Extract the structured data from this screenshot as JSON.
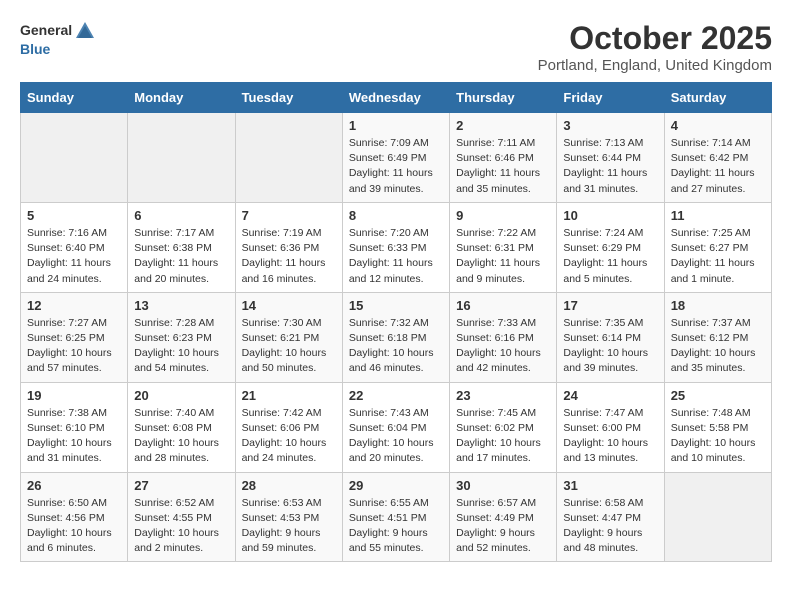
{
  "logo": {
    "general": "General",
    "blue": "Blue"
  },
  "title": "October 2025",
  "location": "Portland, England, United Kingdom",
  "days_of_week": [
    "Sunday",
    "Monday",
    "Tuesday",
    "Wednesday",
    "Thursday",
    "Friday",
    "Saturday"
  ],
  "weeks": [
    [
      {
        "day": "",
        "sunrise": "",
        "sunset": "",
        "daylight": ""
      },
      {
        "day": "",
        "sunrise": "",
        "sunset": "",
        "daylight": ""
      },
      {
        "day": "",
        "sunrise": "",
        "sunset": "",
        "daylight": ""
      },
      {
        "day": "1",
        "sunrise": "Sunrise: 7:09 AM",
        "sunset": "Sunset: 6:49 PM",
        "daylight": "Daylight: 11 hours and 39 minutes."
      },
      {
        "day": "2",
        "sunrise": "Sunrise: 7:11 AM",
        "sunset": "Sunset: 6:46 PM",
        "daylight": "Daylight: 11 hours and 35 minutes."
      },
      {
        "day": "3",
        "sunrise": "Sunrise: 7:13 AM",
        "sunset": "Sunset: 6:44 PM",
        "daylight": "Daylight: 11 hours and 31 minutes."
      },
      {
        "day": "4",
        "sunrise": "Sunrise: 7:14 AM",
        "sunset": "Sunset: 6:42 PM",
        "daylight": "Daylight: 11 hours and 27 minutes."
      }
    ],
    [
      {
        "day": "5",
        "sunrise": "Sunrise: 7:16 AM",
        "sunset": "Sunset: 6:40 PM",
        "daylight": "Daylight: 11 hours and 24 minutes."
      },
      {
        "day": "6",
        "sunrise": "Sunrise: 7:17 AM",
        "sunset": "Sunset: 6:38 PM",
        "daylight": "Daylight: 11 hours and 20 minutes."
      },
      {
        "day": "7",
        "sunrise": "Sunrise: 7:19 AM",
        "sunset": "Sunset: 6:36 PM",
        "daylight": "Daylight: 11 hours and 16 minutes."
      },
      {
        "day": "8",
        "sunrise": "Sunrise: 7:20 AM",
        "sunset": "Sunset: 6:33 PM",
        "daylight": "Daylight: 11 hours and 12 minutes."
      },
      {
        "day": "9",
        "sunrise": "Sunrise: 7:22 AM",
        "sunset": "Sunset: 6:31 PM",
        "daylight": "Daylight: 11 hours and 9 minutes."
      },
      {
        "day": "10",
        "sunrise": "Sunrise: 7:24 AM",
        "sunset": "Sunset: 6:29 PM",
        "daylight": "Daylight: 11 hours and 5 minutes."
      },
      {
        "day": "11",
        "sunrise": "Sunrise: 7:25 AM",
        "sunset": "Sunset: 6:27 PM",
        "daylight": "Daylight: 11 hours and 1 minute."
      }
    ],
    [
      {
        "day": "12",
        "sunrise": "Sunrise: 7:27 AM",
        "sunset": "Sunset: 6:25 PM",
        "daylight": "Daylight: 10 hours and 57 minutes."
      },
      {
        "day": "13",
        "sunrise": "Sunrise: 7:28 AM",
        "sunset": "Sunset: 6:23 PM",
        "daylight": "Daylight: 10 hours and 54 minutes."
      },
      {
        "day": "14",
        "sunrise": "Sunrise: 7:30 AM",
        "sunset": "Sunset: 6:21 PM",
        "daylight": "Daylight: 10 hours and 50 minutes."
      },
      {
        "day": "15",
        "sunrise": "Sunrise: 7:32 AM",
        "sunset": "Sunset: 6:18 PM",
        "daylight": "Daylight: 10 hours and 46 minutes."
      },
      {
        "day": "16",
        "sunrise": "Sunrise: 7:33 AM",
        "sunset": "Sunset: 6:16 PM",
        "daylight": "Daylight: 10 hours and 42 minutes."
      },
      {
        "day": "17",
        "sunrise": "Sunrise: 7:35 AM",
        "sunset": "Sunset: 6:14 PM",
        "daylight": "Daylight: 10 hours and 39 minutes."
      },
      {
        "day": "18",
        "sunrise": "Sunrise: 7:37 AM",
        "sunset": "Sunset: 6:12 PM",
        "daylight": "Daylight: 10 hours and 35 minutes."
      }
    ],
    [
      {
        "day": "19",
        "sunrise": "Sunrise: 7:38 AM",
        "sunset": "Sunset: 6:10 PM",
        "daylight": "Daylight: 10 hours and 31 minutes."
      },
      {
        "day": "20",
        "sunrise": "Sunrise: 7:40 AM",
        "sunset": "Sunset: 6:08 PM",
        "daylight": "Daylight: 10 hours and 28 minutes."
      },
      {
        "day": "21",
        "sunrise": "Sunrise: 7:42 AM",
        "sunset": "Sunset: 6:06 PM",
        "daylight": "Daylight: 10 hours and 24 minutes."
      },
      {
        "day": "22",
        "sunrise": "Sunrise: 7:43 AM",
        "sunset": "Sunset: 6:04 PM",
        "daylight": "Daylight: 10 hours and 20 minutes."
      },
      {
        "day": "23",
        "sunrise": "Sunrise: 7:45 AM",
        "sunset": "Sunset: 6:02 PM",
        "daylight": "Daylight: 10 hours and 17 minutes."
      },
      {
        "day": "24",
        "sunrise": "Sunrise: 7:47 AM",
        "sunset": "Sunset: 6:00 PM",
        "daylight": "Daylight: 10 hours and 13 minutes."
      },
      {
        "day": "25",
        "sunrise": "Sunrise: 7:48 AM",
        "sunset": "Sunset: 5:58 PM",
        "daylight": "Daylight: 10 hours and 10 minutes."
      }
    ],
    [
      {
        "day": "26",
        "sunrise": "Sunrise: 6:50 AM",
        "sunset": "Sunset: 4:56 PM",
        "daylight": "Daylight: 10 hours and 6 minutes."
      },
      {
        "day": "27",
        "sunrise": "Sunrise: 6:52 AM",
        "sunset": "Sunset: 4:55 PM",
        "daylight": "Daylight: 10 hours and 2 minutes."
      },
      {
        "day": "28",
        "sunrise": "Sunrise: 6:53 AM",
        "sunset": "Sunset: 4:53 PM",
        "daylight": "Daylight: 9 hours and 59 minutes."
      },
      {
        "day": "29",
        "sunrise": "Sunrise: 6:55 AM",
        "sunset": "Sunset: 4:51 PM",
        "daylight": "Daylight: 9 hours and 55 minutes."
      },
      {
        "day": "30",
        "sunrise": "Sunrise: 6:57 AM",
        "sunset": "Sunset: 4:49 PM",
        "daylight": "Daylight: 9 hours and 52 minutes."
      },
      {
        "day": "31",
        "sunrise": "Sunrise: 6:58 AM",
        "sunset": "Sunset: 4:47 PM",
        "daylight": "Daylight: 9 hours and 48 minutes."
      },
      {
        "day": "",
        "sunrise": "",
        "sunset": "",
        "daylight": ""
      }
    ]
  ]
}
